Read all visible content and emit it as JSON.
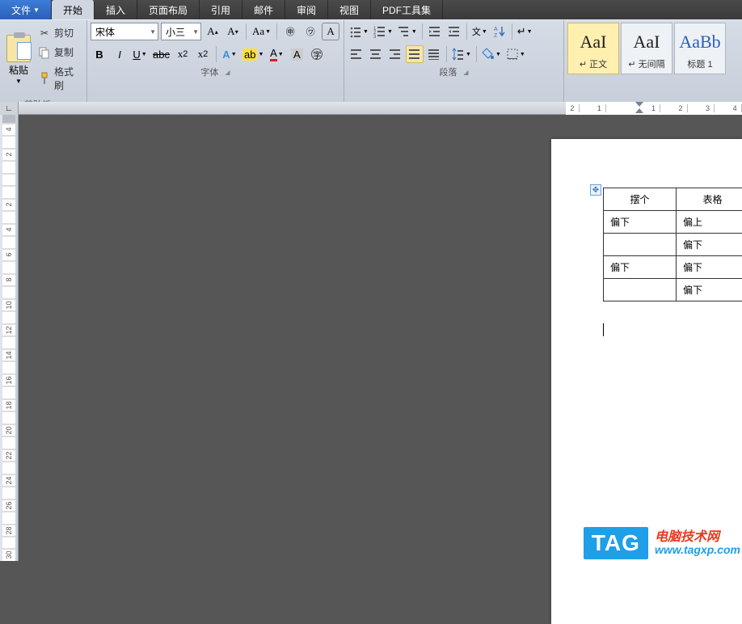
{
  "tabs": {
    "file": "文件",
    "home": "开始",
    "insert": "插入",
    "layout": "页面布局",
    "ref": "引用",
    "mail": "邮件",
    "review": "审阅",
    "view": "视图",
    "pdf": "PDF工具集"
  },
  "clipboard": {
    "paste": "粘贴",
    "cut": "剪切",
    "copy": "复制",
    "format_painter": "格式刷",
    "title": "剪贴板"
  },
  "font": {
    "name": "宋体",
    "size": "小三",
    "title": "字体"
  },
  "paragraph": {
    "title": "段落"
  },
  "style_items": [
    {
      "sample": "AaI",
      "label": "↵ 正文"
    },
    {
      "sample": "AaI",
      "label": "↵ 无间隔"
    },
    {
      "sample": "AaBb",
      "label": "标题 1"
    }
  ],
  "table": {
    "rows": [
      [
        "摆个",
        "表格"
      ],
      [
        "偏下",
        "偏上"
      ],
      [
        "",
        "偏下"
      ],
      [
        "偏下",
        "偏下"
      ],
      [
        "",
        "偏下"
      ]
    ]
  },
  "ruler_h": [
    "2",
    "",
    "1",
    "",
    "",
    "",
    "1",
    "",
    "2",
    "",
    "3",
    "",
    "4"
  ],
  "ruler_v": [
    "4",
    "",
    "2",
    "",
    "",
    "",
    "2",
    "",
    "4",
    "",
    "6",
    "",
    "8",
    "",
    "10",
    "",
    "12",
    "",
    "14",
    "",
    "16",
    "",
    "18",
    "",
    "20",
    "",
    "22",
    "",
    "24",
    "",
    "26",
    "",
    "28",
    "",
    "30"
  ],
  "watermark": {
    "tag": "TAG",
    "line1": "电脑技术网",
    "line2": "www.tagxp.com"
  }
}
